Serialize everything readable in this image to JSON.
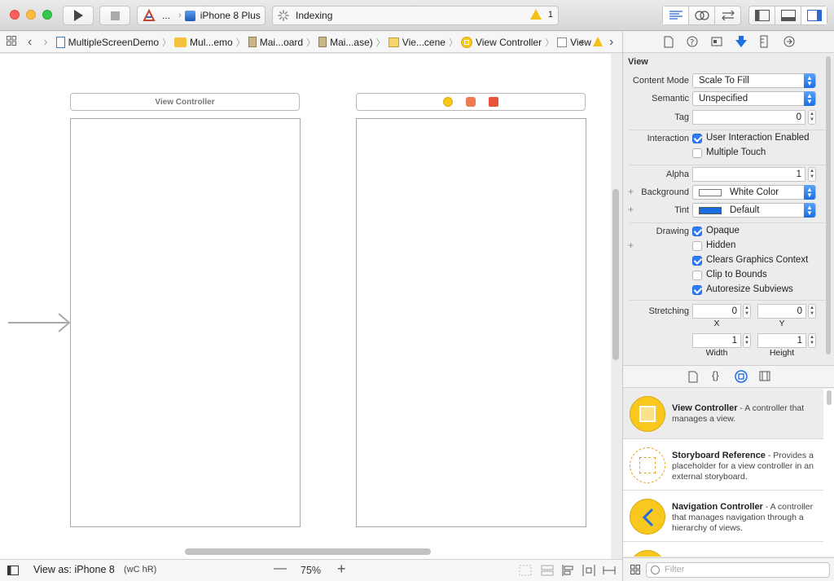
{
  "toolbar": {
    "scheme_app_label": "...",
    "device_label": "iPhone 8 Plus",
    "activity_label": "Indexing",
    "warning_count": "1"
  },
  "jumpbar": {
    "crumbs": [
      "MultipleScreenDemo",
      "Mul...emo",
      "Mai...oard",
      "Mai...ase)",
      "Vie...cene",
      "View Controller",
      "View"
    ]
  },
  "canvas": {
    "scene1_title": "View Controller"
  },
  "bottombar": {
    "view_as_label": "View as: iPhone 8",
    "size_class": "(wC hR)",
    "zoom": "75%"
  },
  "inspector": {
    "section_title": "View",
    "content_mode": {
      "label": "Content Mode",
      "value": "Scale To Fill"
    },
    "semantic": {
      "label": "Semantic",
      "value": "Unspecified"
    },
    "tag": {
      "label": "Tag",
      "value": "0"
    },
    "interaction": {
      "label": "Interaction",
      "user_interaction": "User Interaction Enabled",
      "multiple_touch": "Multiple Touch"
    },
    "alpha": {
      "label": "Alpha",
      "value": "1"
    },
    "background": {
      "label": "Background",
      "value": "White Color"
    },
    "tint": {
      "label": "Tint",
      "value": "Default"
    },
    "drawing": {
      "label": "Drawing",
      "opaque": "Opaque",
      "hidden": "Hidden",
      "clears": "Clears Graphics Context",
      "clip": "Clip to Bounds",
      "autoresize": "Autoresize Subviews"
    },
    "stretching": {
      "label": "Stretching",
      "x": "0",
      "y": "0",
      "width": "1",
      "height": "1",
      "x_label": "X",
      "y_label": "Y",
      "width_label": "Width",
      "height_label": "Height"
    }
  },
  "library": {
    "items": [
      {
        "name": "View Controller",
        "desc": " - A controller that manages a view."
      },
      {
        "name": "Storyboard Reference",
        "desc": " - Provides a placeholder for a view controller in an external storyboard."
      },
      {
        "name": "Navigation Controller",
        "desc": " - A controller that manages navigation through a hierarchy of views."
      }
    ],
    "filter_placeholder": "Filter"
  },
  "colors": {
    "accent": "#2f7cf6",
    "library_yellow": "#f8c81e",
    "tint_blue": "#1a6fe0"
  }
}
